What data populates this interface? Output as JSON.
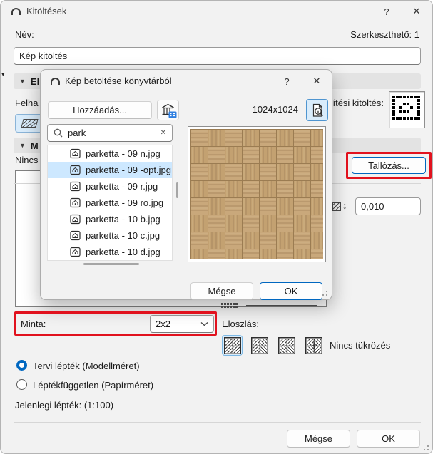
{
  "window": {
    "title": "Kitöltések",
    "help_button": "?",
    "close_button": "✕"
  },
  "main": {
    "name_label": "Név:",
    "editable_count_label": "Szerkeszthető: 1",
    "fill_name_value": "Kép kitöltés",
    "section_availability_fragment": "El",
    "usage_label_fragment": "Felha",
    "simplified_fill_label_fragment": "ítési kitöltés:",
    "section_pattern_fragment": "M",
    "no_preview_fragment": "Nincs",
    "browse_button": "Tallózás...",
    "pattern_spacing_value": "0,010",
    "updown_arrow": "↕",
    "sample_label": "Minta:",
    "sample_value": "2x2",
    "distribution_label": "Eloszlás:",
    "mirror_status_label": "Nincs tükrözés",
    "scale_radio_model": "Tervi lépték (Modellméret)",
    "scale_radio_paper": "Léptékfüggetlen (Papírméret)",
    "current_scale_label": "Jelenlegi lépték: (1:100)",
    "cancel_button": "Mégse",
    "ok_button": "OK"
  },
  "modal": {
    "title": "Kép betöltése könyvtárból",
    "help_button": "?",
    "close_button": "✕",
    "add_button": "Hozzáadás...",
    "image_size_label": "1024x1024",
    "search_value": "park",
    "search_clear": "✕",
    "files": [
      "parketta - 09 n.jpg",
      "parketta - 09 -opt.jpg",
      "parketta - 09 r.jpg",
      "parketta - 09 ro.jpg",
      "parketta - 10 b.jpg",
      "parketta - 10 c.jpg",
      "parketta - 10 d.jpg"
    ],
    "selected_file_index": 1,
    "cancel_button": "Mégse",
    "ok_button": "OK"
  },
  "colors": {
    "accent_blue": "#0067c0",
    "selection_blue": "#cde8ff",
    "highlight_red": "#e1121e",
    "wood_base": "#c9a87b",
    "wood_line": "#aa8a60"
  },
  "icons": [
    "archicad-logo",
    "help",
    "close",
    "library-add-icon",
    "search-icon",
    "clear-icon",
    "image-file-icon",
    "preview-info-icon",
    "hatch-sample-icon",
    "updown-arrow-icon",
    "distribution-no-mirror-icon",
    "distribution-mirror-x-icon",
    "distribution-mirror-y-icon",
    "distribution-mirror-both-icon",
    "resize-grip"
  ]
}
